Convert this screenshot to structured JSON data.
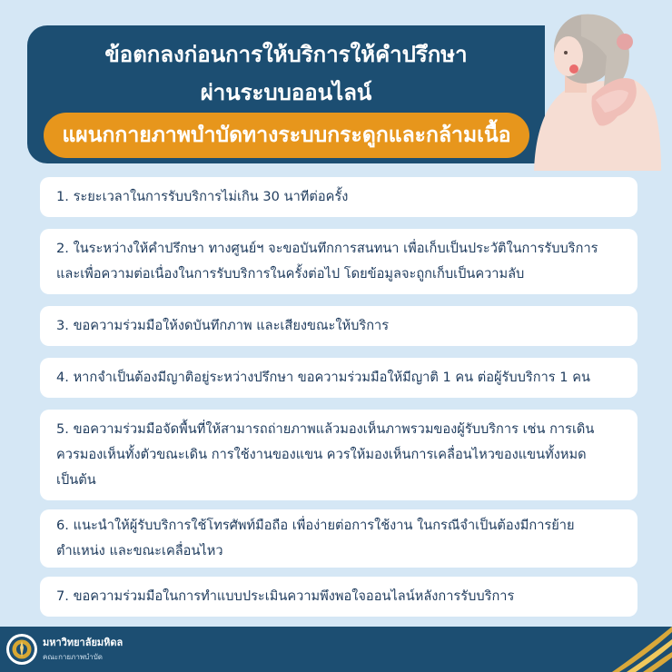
{
  "header": {
    "title_line1": "ข้อตกลงก่อนการให้บริการให้คำปรึกษา",
    "title_line2": "ผ่านระบบออนไลน์",
    "subtitle": "แผนกกายภาพบำบัดทางระบบกระดูกและกล้ามเนื้อ"
  },
  "items": [
    {
      "line1": "1. ระยะเวลาในการรับบริการไม่เกิน 30 นาทีต่อครั้ง"
    },
    {
      "line1": "2. ในระหว่างให้คำปรึกษา ทางศูนย์ฯ จะขอบันทึกการสนทนา เพื่อเก็บเป็นประวัติในการรับบริการ",
      "line2": "และเพื่อความต่อเนื่องในการรับบริการในครั้งต่อไป โดยข้อมูลจะถูกเก็บเป็นความลับ"
    },
    {
      "line1": "3. ขอความร่วมมือให้งดบันทึกภาพ และเสียงขณะให้บริการ"
    },
    {
      "line1": "4. หากจำเป็นต้องมีญาติอยู่ระหว่างปรึกษา ขอความร่วมมือให้มีญาติ 1 คน ต่อผู้รับบริการ 1 คน"
    },
    {
      "line1": "5. ขอความร่วมมือจัดพื้นที่ให้สามารถถ่ายภาพแล้วมองเห็นภาพรวมของผู้รับบริการ เช่น การเดิน",
      "line2": "ควรมองเห็นทั้งตัวขณะเดิน การใช้งานของแขน ควรให้มองเห็นการเคลื่อนไหวของแขนทั้งหมด",
      "line3": "เป็นต้น"
    },
    {
      "line1": "6. แนะนำให้ผู้รับบริการใช้โทรศัพท์มือถือ เพื่อง่ายต่อการใช้งาน ในกรณีจำเป็นต้องมีการย้าย",
      "line2": "ตำแหน่ง และขณะเคลื่อนไหว"
    },
    {
      "line1": "7. ขอความร่วมมือในการทำแบบประเมินความพึงพอใจออนไลน์หลังการรับบริการ"
    }
  ],
  "footer": {
    "org_name": "มหาวิทยาลัยมหิดล",
    "org_sub": "คณะกายภาพบำบัด"
  },
  "colors": {
    "background": "#d5e7f5",
    "header_navy": "#1c4e72",
    "accent_orange": "#e7961c",
    "body_text": "#1d3a5c",
    "card": "#ffffff"
  },
  "icons": [
    "woman-shoulder-pain-illustration",
    "university-seal-logo",
    "gold-swoosh"
  ]
}
